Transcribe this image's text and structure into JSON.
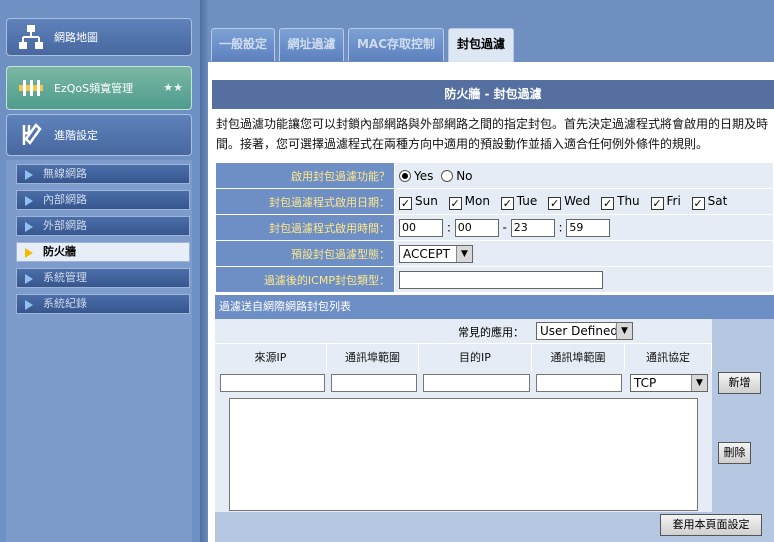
{
  "sidebar": {
    "network_map": "網路地圖",
    "ezqos": "EzQoS頻寬管理",
    "advanced": "進階設定",
    "items": [
      "無線網路",
      "內部網路",
      "外部網路",
      "防火牆",
      "系統管理",
      "系統紀錄"
    ],
    "active_index": 3
  },
  "tabs": [
    "一般設定",
    "網址過濾",
    "MAC存取控制",
    "封包過濾"
  ],
  "active_tab": 3,
  "title": "防火牆 - 封包過濾",
  "description_line1": "封包過濾功能讓您可以封鎖內部網路與外部網路之間的指定封包。首先決定過濾程式將會啟用的日期及時",
  "description_line2": "間。接著，您可選擇過濾程式在兩種方向中適用的預設動作並插入適合任何例外條件的規則。",
  "form": {
    "enable_label": "啟用封包過濾功能？",
    "yes": "Yes",
    "no": "No",
    "date_label": "封包過濾程式啟用日期：",
    "days": [
      "Sun",
      "Mon",
      "Tue",
      "Wed",
      "Thu",
      "Fri",
      "Sat"
    ],
    "time_label": "封包過濾程式啟用時間：",
    "time_start_h": "00",
    "time_start_m": "00",
    "time_end_h": "23",
    "time_end_m": "59",
    "time_sep1": ":",
    "time_dash": "-",
    "time_sep2": ":",
    "default_label": "預設封包過濾型態：",
    "default_value": "ACCEPT",
    "icmp_label": "過濾後的ICMP封包類型：",
    "icmp_value": ""
  },
  "list": {
    "title": "過濾送自網際網路封包列表",
    "common_app_label": "常見的應用：",
    "common_app_value": "User Defined",
    "col_src_ip": "來源IP",
    "col_src_port": "通訊埠範圍",
    "col_dst_ip": "目的IP",
    "col_dst_port": "通訊埠範圍",
    "col_protocol": "通訊協定",
    "protocol_value": "TCP",
    "add_button": "新增",
    "delete_button": "刪除",
    "apply_button": "套用本頁面設定"
  }
}
